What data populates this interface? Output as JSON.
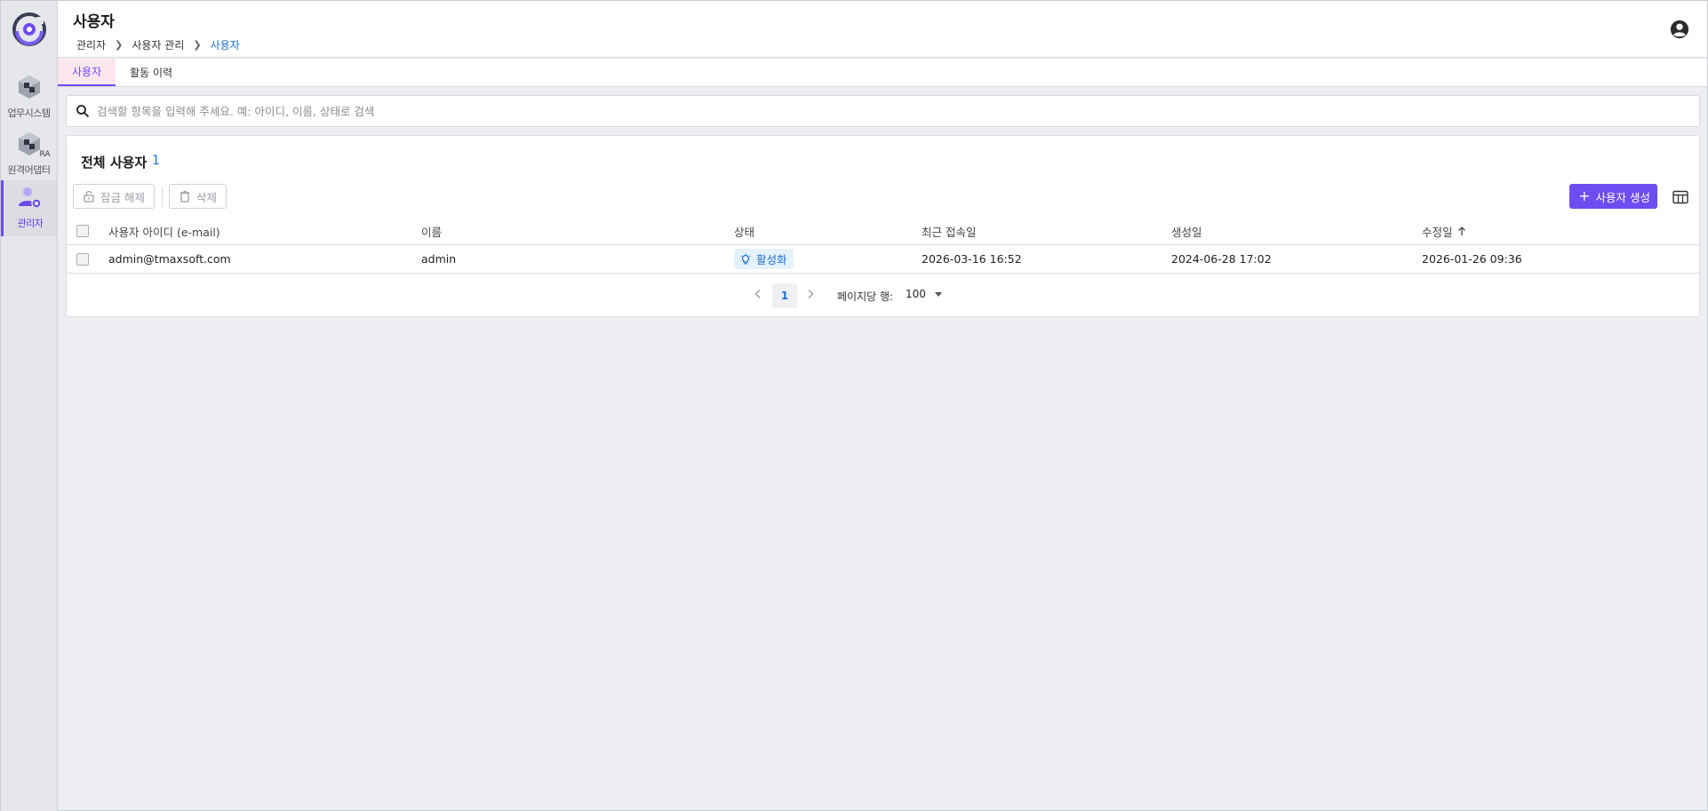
{
  "sidebar": {
    "items": [
      {
        "label": "업무시스템",
        "icon": "cube-icon"
      },
      {
        "label": "원격어댑터",
        "icon": "cube-icon",
        "badge": "RA"
      },
      {
        "label": "관리자",
        "icon": "admin-user-icon"
      }
    ]
  },
  "header": {
    "title": "사용자",
    "breadcrumb": [
      "관리자",
      "사용자 관리",
      "사용자"
    ]
  },
  "tabs": [
    "사용자",
    "활동 이력"
  ],
  "search": {
    "placeholder": "검색할 항목을 입력해 주세요. 예: 아이디, 이름, 상태로 검색"
  },
  "card": {
    "title": "전체 사용자",
    "count": "1",
    "unlock_label": "잠금 해제",
    "delete_label": "삭제",
    "create_label": "사용자 생성"
  },
  "table": {
    "columns": [
      "사용자 아이디 (e-mail)",
      "이름",
      "상태",
      "최근 접속일",
      "생성일",
      "수정일"
    ],
    "rows": [
      {
        "id": "admin@tmaxsoft.com",
        "name": "admin",
        "status": "활성화",
        "last_login": "2026-03-16 16:52",
        "created": "2024-06-28 17:02",
        "modified": "2026-01-26 09:36"
      }
    ]
  },
  "pagination": {
    "page": "1",
    "rows_label": "페이지당 행:",
    "rows_value": "100"
  },
  "colors": {
    "accent": "#6d4cf2",
    "link": "#1c6fd1",
    "active_tab_bg": "#fde7ef",
    "status_bg": "#e6f2fb"
  }
}
